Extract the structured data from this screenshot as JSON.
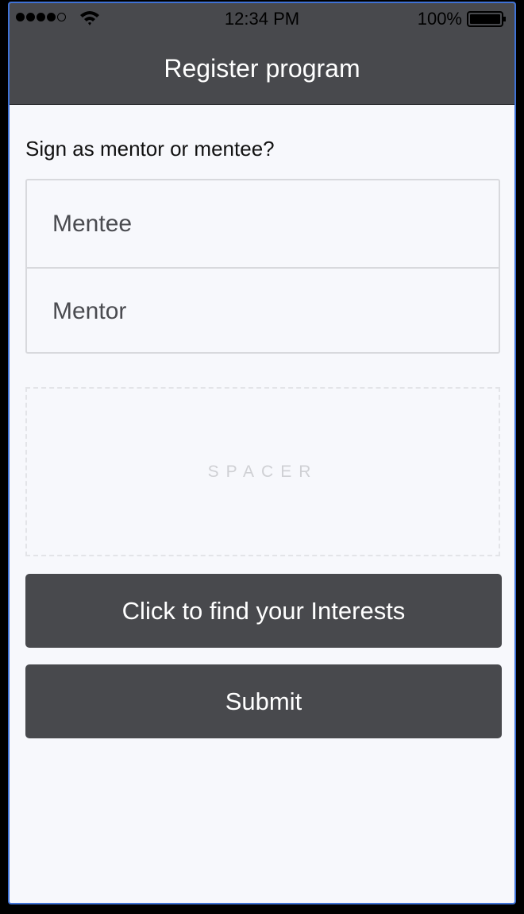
{
  "status_bar": {
    "signal_bars_filled": 4,
    "signal_bars_total": 5,
    "time": "12:34 PM",
    "battery_percent": "100%"
  },
  "nav": {
    "title": "Register program"
  },
  "form": {
    "question": "Sign as mentor or mentee?",
    "options": [
      "Mentee",
      "Mentor"
    ]
  },
  "spacer": {
    "label": "SPACER"
  },
  "buttons": {
    "interests": "Click to find your Interests",
    "submit": "Submit"
  },
  "colors": {
    "bar": "#48494d",
    "background": "#f7f8fc",
    "button": "#48494d",
    "frame_border": "#3f72d6"
  }
}
